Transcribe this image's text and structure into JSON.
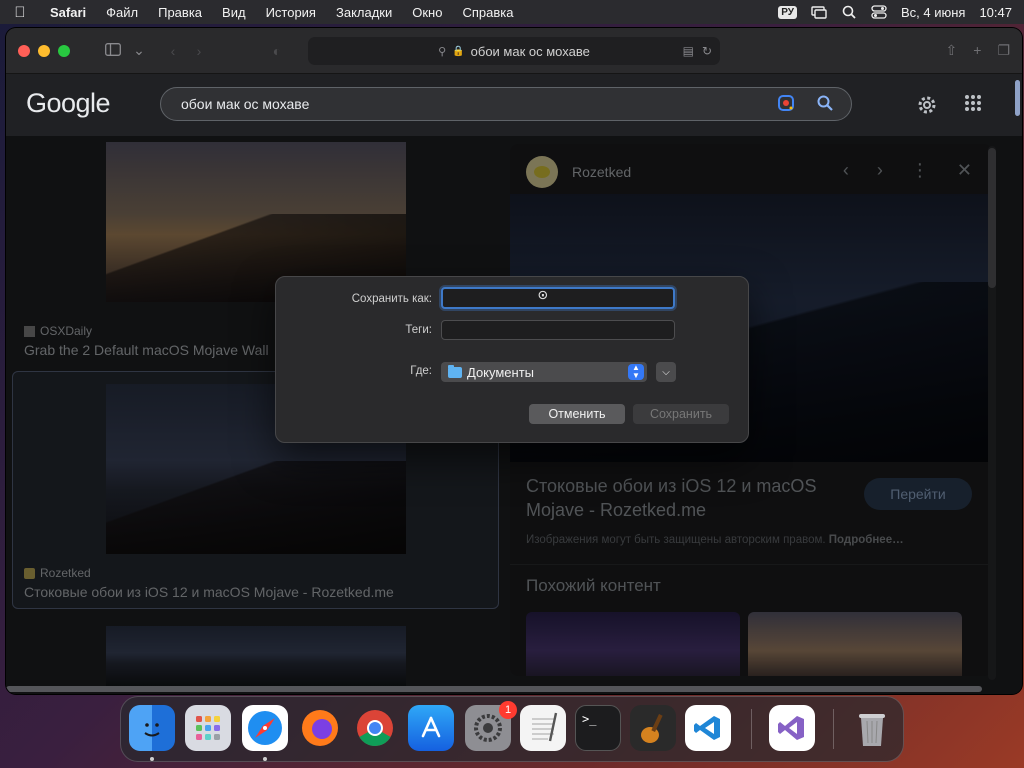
{
  "menubar": {
    "app_name": "Safari",
    "items": [
      "Файл",
      "Правка",
      "Вид",
      "История",
      "Закладки",
      "Окно",
      "Справка"
    ],
    "lang": "РУ",
    "datetime": "Вс, 4 июня",
    "clock": "10:47"
  },
  "safari": {
    "address": "обои мак ос мохаве"
  },
  "google": {
    "logo": "Google",
    "query": "обои мак ос мохаве"
  },
  "results": {
    "card1": {
      "source": "OSXDaily",
      "title": "Grab the 2 Default macOS Mojave Wall"
    },
    "card2": {
      "source": "Rozetked",
      "title": "Стоковые обои из iOS 12 и macOS Mojave - Rozetked.me"
    }
  },
  "preview": {
    "source": "Rozetked",
    "title": "Стоковые обои из iOS 12 и macOS Mojave - Rozetked.me",
    "go_button": "Перейти",
    "copyright": "Изображения могут быть защищены авторским правом.",
    "more_link": "Подробнее…",
    "similar_heading": "Похожий контент"
  },
  "dialog": {
    "save_as_label": "Сохранить как:",
    "save_as_value": "",
    "tags_label": "Теги:",
    "where_label": "Где:",
    "where_value": "Документы",
    "cancel_button": "Отменить",
    "save_button": "Сохранить"
  },
  "dock": {
    "apps": [
      "Finder",
      "Launchpad",
      "Safari",
      "Firefox",
      "Chrome",
      "App Store",
      "System Settings",
      "TextEdit",
      "Terminal",
      "GarageBand",
      "VS Code",
      "Visual Studio",
      "Trash"
    ],
    "settings_badge": "1"
  },
  "colors": {
    "accent": "#3478f6",
    "focus_ring": "#3e79c8",
    "badge": "#ff3b30"
  }
}
